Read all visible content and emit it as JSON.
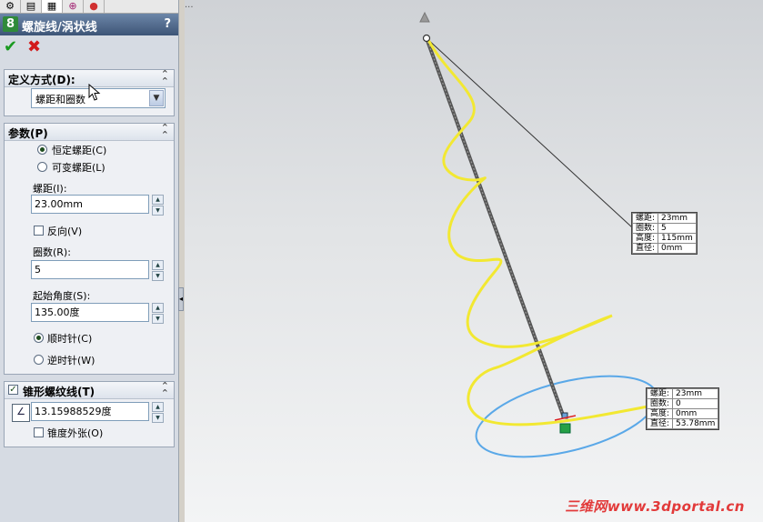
{
  "panel_tabs": [
    "feature-manager-icon",
    "property-manager-icon",
    "configuration-icon",
    "dimxpert-icon",
    "appearance-icon"
  ],
  "title": "螺旋线/涡状线",
  "help": "?",
  "define_by": {
    "header": "定义方式(D):",
    "selected": "螺距和圈数"
  },
  "params": {
    "header": "参数(P)",
    "constant_pitch": "恒定螺距(C)",
    "variable_pitch": "可变螺距(L)",
    "pitch_label": "螺距(I):",
    "pitch_value": "23.00mm",
    "reverse_label": "反向(V)",
    "revolutions_label": "圈数(R):",
    "revolutions_value": "5",
    "start_angle_label": "起始角度(S):",
    "start_angle_value": "135.00度",
    "clockwise": "顺时针(C)",
    "counterclockwise": "逆时针(W)"
  },
  "taper": {
    "header": "锥形螺纹线(T)",
    "angle_value": "13.15988529度",
    "taper_outward": "锥度外张(O)"
  },
  "viewport": {
    "crumb": "...",
    "callout_top": [
      [
        "螺距:",
        "23mm"
      ],
      [
        "圈数:",
        "5"
      ],
      [
        "高度:",
        "115mm"
      ],
      [
        "直径:",
        "0mm"
      ]
    ],
    "callout_bottom": [
      [
        "螺距:",
        "23mm"
      ],
      [
        "圈数:",
        "0"
      ],
      [
        "高度:",
        "0mm"
      ],
      [
        "直径:",
        "53.78mm"
      ]
    ]
  },
  "watermark": "三维网www.3dportal.cn",
  "colors": {
    "helix": "#f2e832",
    "circle": "#5aa8e8",
    "axis": "#555555",
    "title_bar": "#4a6488"
  }
}
